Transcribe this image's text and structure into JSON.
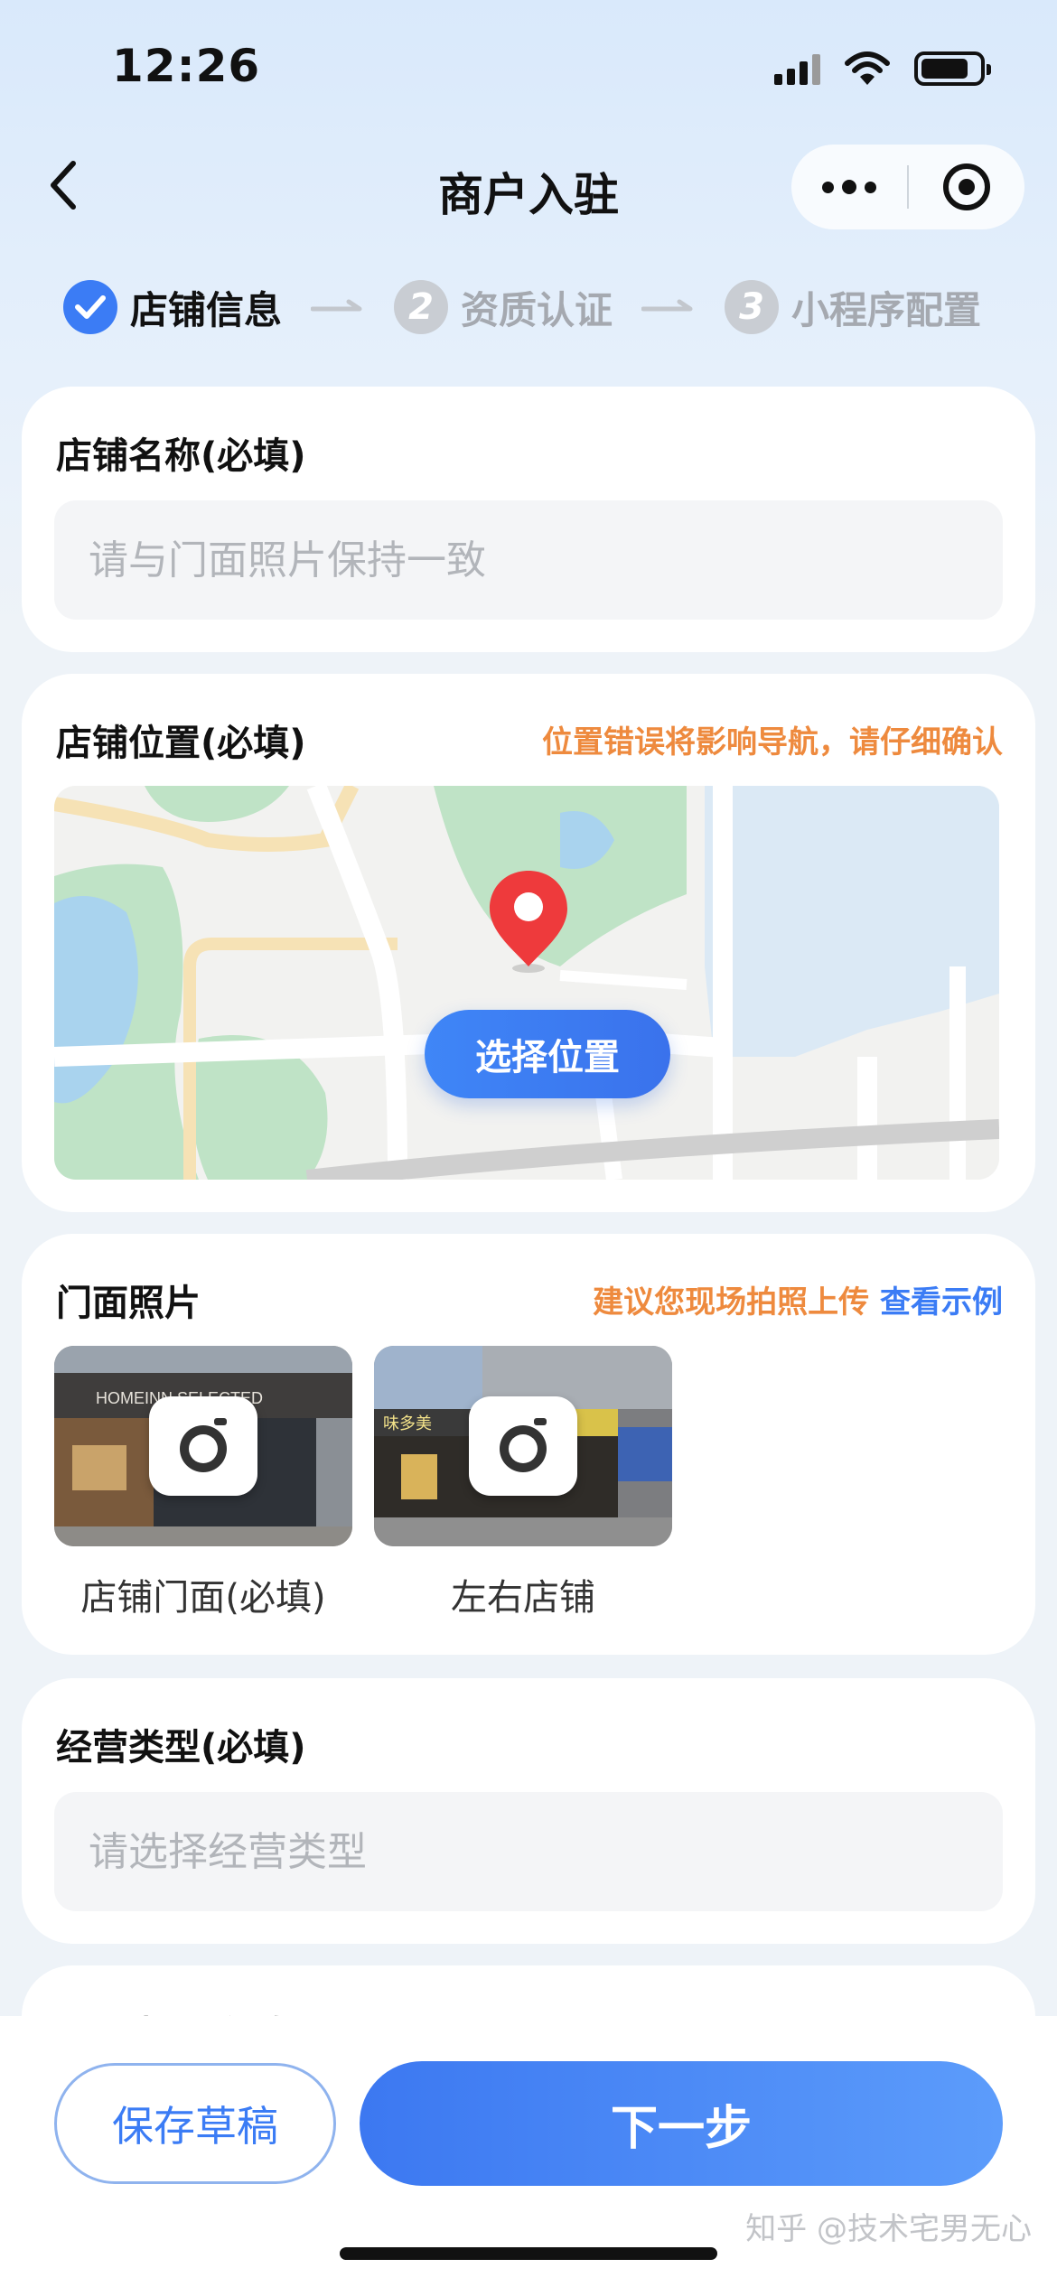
{
  "status_bar": {
    "time": "12:26"
  },
  "nav": {
    "title": "商户入驻"
  },
  "steps": [
    {
      "number": "1",
      "label": "店铺信息",
      "state": "done"
    },
    {
      "number": "2",
      "label": "资质认证",
      "state": "pending"
    },
    {
      "number": "3",
      "label": "小程序配置",
      "state": "pending"
    }
  ],
  "store_name": {
    "label": "店铺名称(必填)",
    "value": "",
    "placeholder": "请与门面照片保持一致"
  },
  "store_location": {
    "label": "店铺位置(必填)",
    "hint": "位置错误将影响导航，请仔细确认",
    "select_button": "选择位置"
  },
  "storefront_photos": {
    "label": "门面照片",
    "hint": "建议您现场拍照上传",
    "example_link": "查看示例",
    "photos": [
      {
        "caption": "店铺门面(必填)",
        "sign_text": "HOMEINN SELECTED",
        "icon": "camera-icon"
      },
      {
        "caption": "左右店铺",
        "sign_text": "味多美",
        "icon": "camera-icon"
      }
    ]
  },
  "business_type": {
    "label": "经营类型(必填)",
    "value": "",
    "placeholder": "请选择经营类型"
  },
  "contact_phone": {
    "label": "联系电话(必填)"
  },
  "footer": {
    "save_draft": "保存草稿",
    "next": "下一步",
    "watermark": "知乎 @技术宅男无心"
  },
  "colors": {
    "accent": "#3b7cf5",
    "warning": "#ee8a3e",
    "pending": "#c9cdd3"
  }
}
